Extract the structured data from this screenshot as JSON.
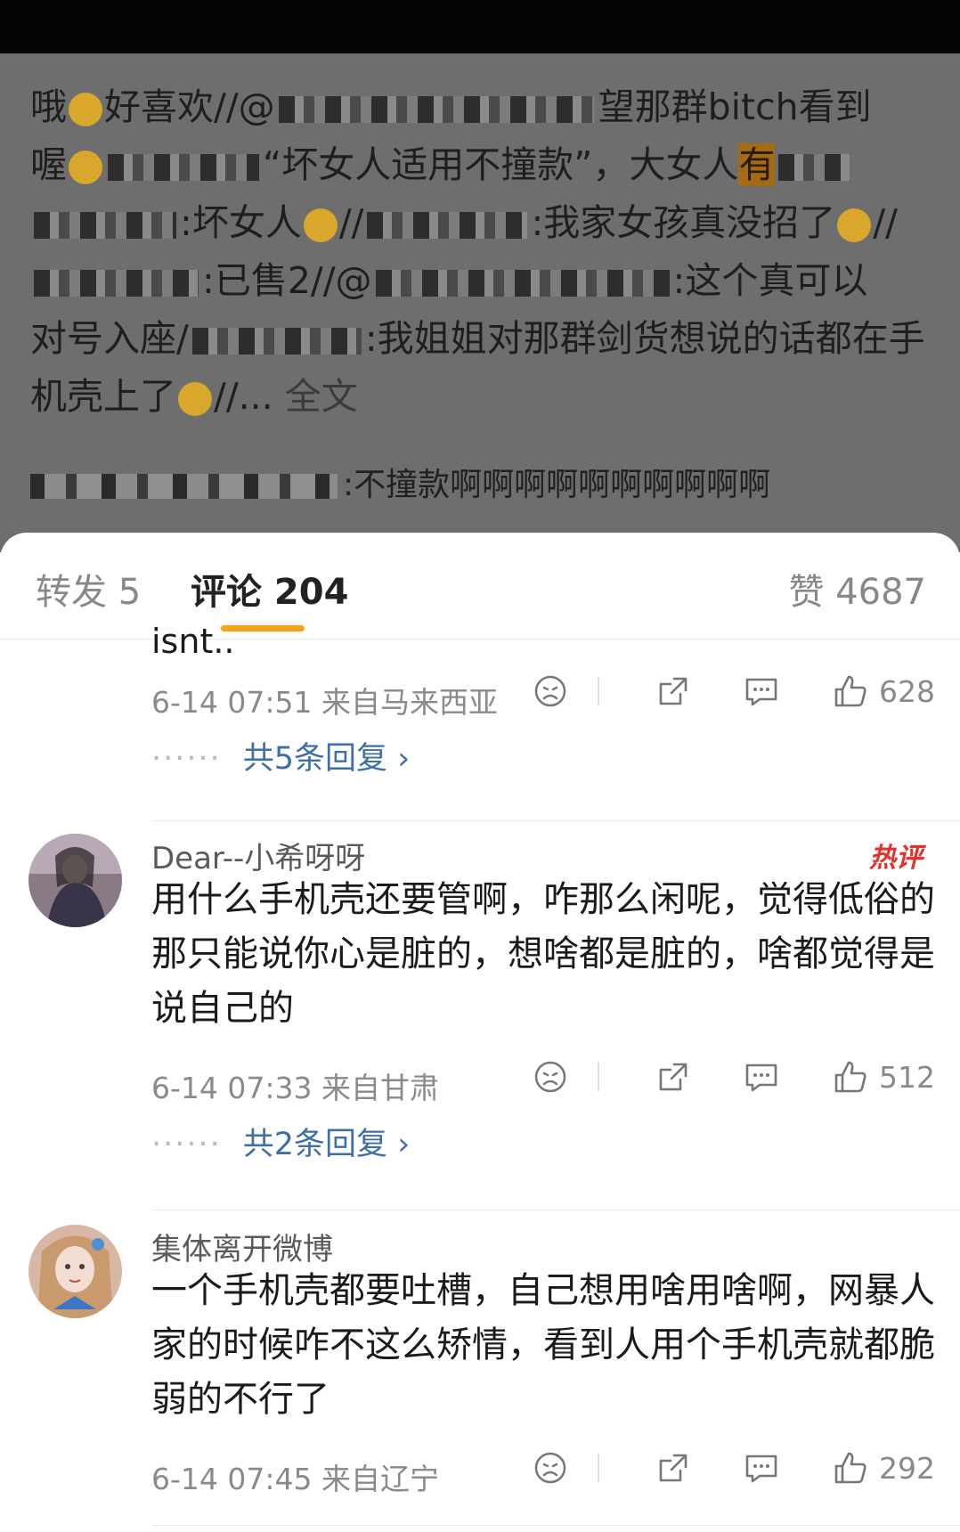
{
  "post": {
    "line1a": "哦",
    "line1b": "好喜欢//@",
    "line1c": "望那群bitch看到",
    "line2a": "喔",
    "line2b": "“坏女人适用不撞款”，大女人",
    "line2c": "有",
    "line3a": ":坏女人",
    "line3b": "//",
    "line3c": ":我家女孩真没招了",
    "line3d": "//",
    "line4a": ":已售2//@",
    "line4b": ":这个真可以",
    "line5a": "对号入座/",
    "line5b": ":我姐姐对那群剑货想说的话都在手",
    "line6a": "机壳上了",
    "line6b": "//...",
    "full_text": "全文",
    "repost_text": ":不撞款啊啊啊啊啊啊啊啊啊啊"
  },
  "tabs": {
    "repost": "转发 5",
    "comment": "评论 204",
    "like": "赞 4687"
  },
  "comments": [
    {
      "truncated": "isnt..",
      "time": "6-14 07:51  来自马来西亚",
      "likes": "628",
      "replies": "共5条回复"
    },
    {
      "user": "Dear--小希呀呀",
      "badge": "热评",
      "text": "用什么手机壳还要管啊，咋那么闲呢，觉得低俗的那只能说你心是脏的，想啥都是脏的，啥都觉得是说自己的",
      "time": "6-14 07:33  来自甘肃",
      "likes": "512",
      "replies": "共2条回复"
    },
    {
      "user": "集体离开微博",
      "text": "一个手机壳都要吐槽，自己想用啥用啥啊，网暴人家的时候咋不这么矫情，看到人用个手机壳就都脆弱的不行了",
      "time": "6-14 07:45  来自辽宁",
      "likes": "292"
    }
  ],
  "icons": [
    "dislike-icon",
    "share-icon",
    "comment-icon",
    "thumbs-up-icon",
    "chevron-right-icon"
  ],
  "colors": {
    "accent": "#f7a21a",
    "link": "#3f6fa8",
    "hot": "#e2322c"
  }
}
